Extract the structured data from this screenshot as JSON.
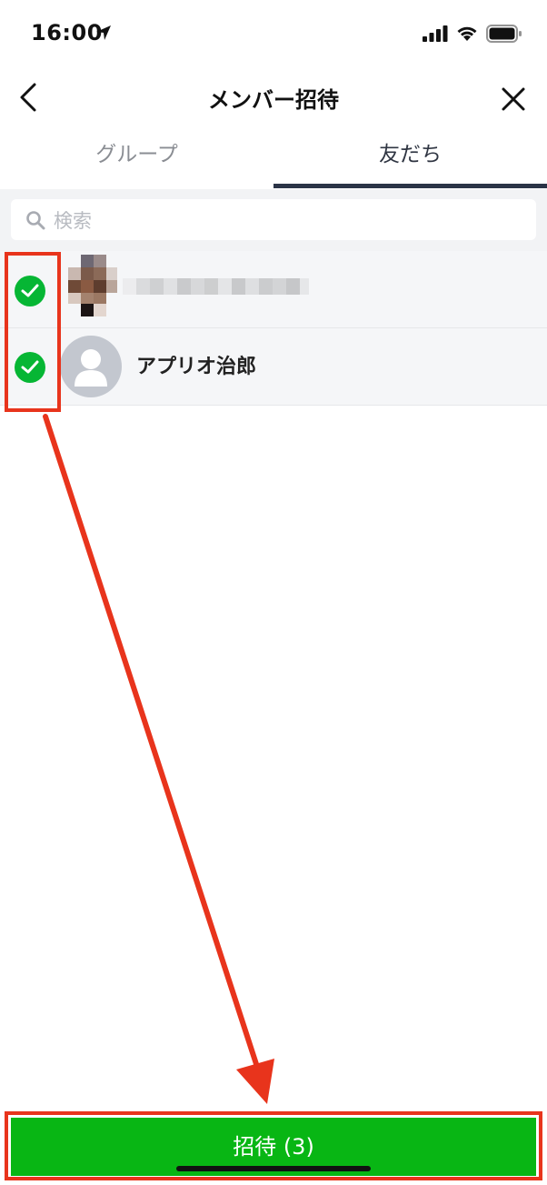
{
  "status_bar": {
    "time": "16:00"
  },
  "nav": {
    "title": "メンバー招待"
  },
  "tabs": [
    {
      "label": "グループ",
      "active": false
    },
    {
      "label": "友だち",
      "active": true
    }
  ],
  "search": {
    "placeholder": "検索",
    "value": ""
  },
  "friends": [
    {
      "name": "",
      "selected": true,
      "pixelated": true
    },
    {
      "name": "アプリオ治郎",
      "selected": true,
      "pixelated": false
    }
  ],
  "invite_button": {
    "label": "招待 (3)"
  },
  "colors": {
    "accent_green": "#06b634",
    "annotation_red": "#e8341c",
    "tab_indicator": "#2b3447"
  }
}
